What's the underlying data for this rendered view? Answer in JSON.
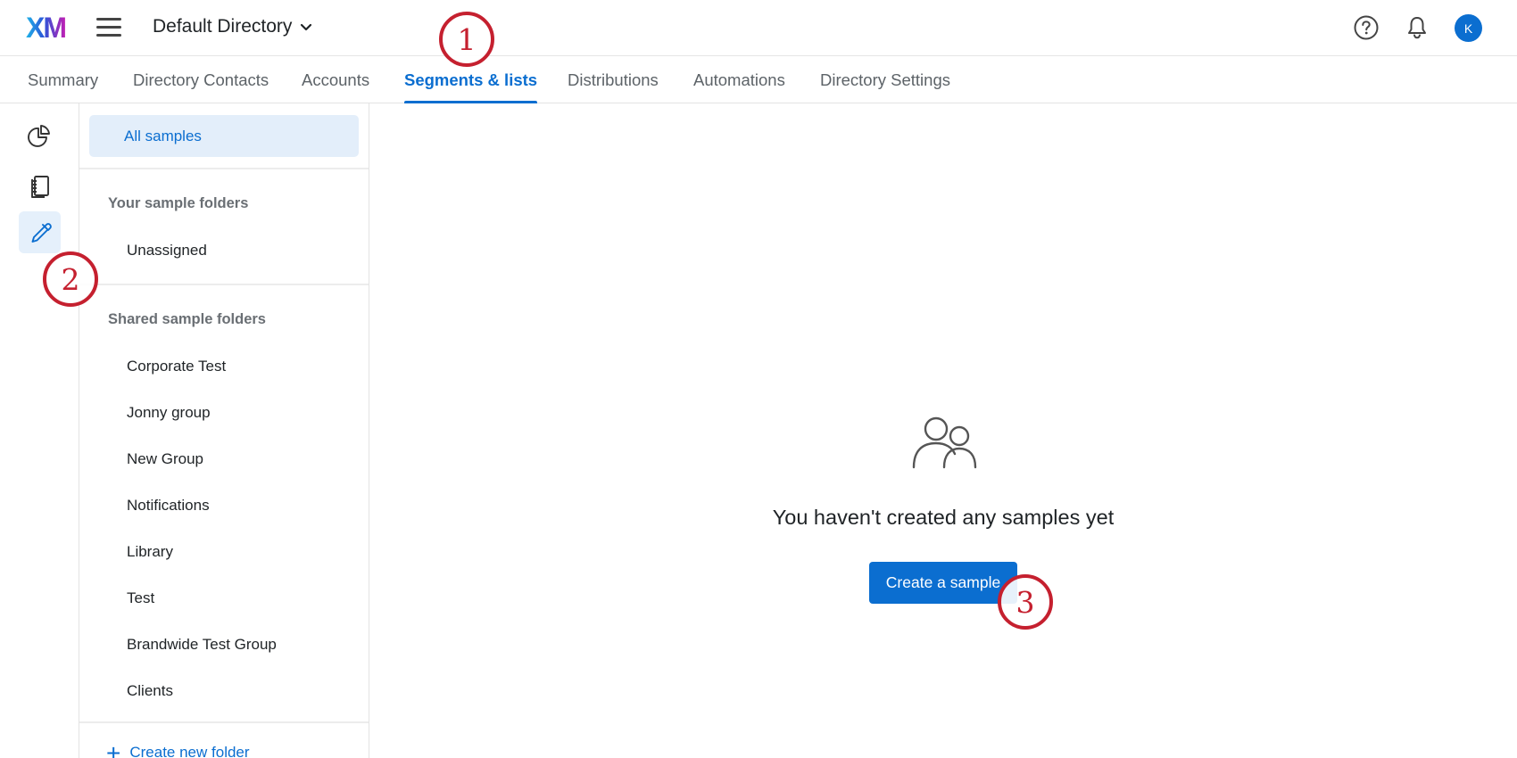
{
  "header": {
    "logo_text": "XM",
    "directory_title": "Default Directory",
    "avatar_initial": "K"
  },
  "tabs": [
    {
      "label": "Summary",
      "active": false
    },
    {
      "label": "Directory Contacts",
      "active": false
    },
    {
      "label": "Accounts",
      "active": false
    },
    {
      "label": "Segments & lists",
      "active": true
    },
    {
      "label": "Distributions",
      "active": false
    },
    {
      "label": "Automations",
      "active": false
    },
    {
      "label": "Directory Settings",
      "active": false
    }
  ],
  "rail": {
    "items": [
      {
        "icon": "pie-chart-icon",
        "active": false
      },
      {
        "icon": "notebook-icon",
        "active": false
      },
      {
        "icon": "dropper-icon",
        "active": true
      }
    ]
  },
  "sidebar": {
    "all_samples": "All samples",
    "your_folders_heading": "Your sample folders",
    "your_folders": [
      "Unassigned"
    ],
    "shared_folders_heading": "Shared sample folders",
    "shared_folders": [
      "Corporate Test",
      "Jonny group",
      "New Group",
      "Notifications",
      "Library",
      "Test",
      "Brandwide Test Group",
      "Clients"
    ],
    "create_folder": "Create new folder"
  },
  "main": {
    "empty_icon": "people-icon",
    "empty_text": "You haven't created any samples yet",
    "create_button": "Create a sample"
  },
  "callouts": [
    "1",
    "2",
    "3"
  ],
  "colors": {
    "accent": "#0b6ed0",
    "callout": "#c5202f",
    "selected_bg": "#e3eefa"
  }
}
